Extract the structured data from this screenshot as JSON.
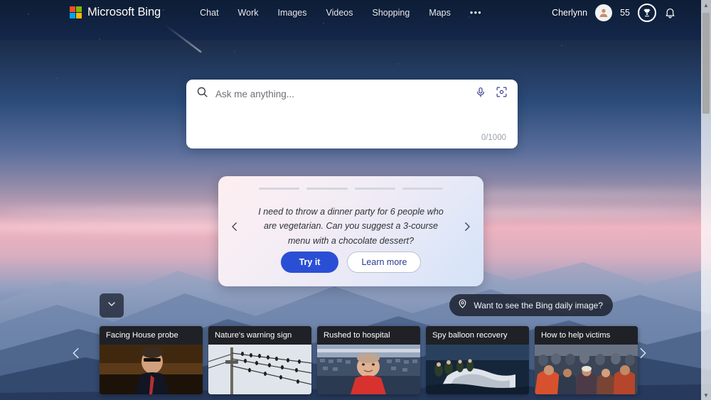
{
  "header": {
    "brand": "Microsoft Bing",
    "logo_icon": "microsoft-squares-logo",
    "logo_colors": [
      "#f25022",
      "#7fba00",
      "#00a4ef",
      "#ffb900"
    ],
    "nav": [
      {
        "label": "Chat",
        "name": "nav-chat"
      },
      {
        "label": "Work",
        "name": "nav-work"
      },
      {
        "label": "Images",
        "name": "nav-images"
      },
      {
        "label": "Videos",
        "name": "nav-videos"
      },
      {
        "label": "Shopping",
        "name": "nav-shopping"
      },
      {
        "label": "Maps",
        "name": "nav-maps"
      }
    ],
    "more_label": "•••",
    "username": "Cherlynn",
    "avatar_icon": "user-avatar-icon",
    "points": "55",
    "rewards_icon": "trophy-icon",
    "notifications_icon": "bell-icon",
    "menu_icon": "hamburger-menu-icon"
  },
  "search": {
    "placeholder": "Ask me anything...",
    "value": "",
    "search_icon": "search-icon",
    "mic_icon": "microphone-icon",
    "visual_icon": "visual-search-camera-icon",
    "counter": "0/1000"
  },
  "suggestion": {
    "prompt": "I need to throw a dinner party for 6 people who are vegetarian. Can you suggest a 3-course menu with a chocolate dessert?",
    "try_label": "Try it",
    "learn_label": "Learn more",
    "prev_icon": "chevron-left-icon",
    "next_icon": "chevron-right-icon",
    "progress": [
      75,
      0,
      0,
      0
    ],
    "active_color": "#2b3a8f"
  },
  "daily_image": {
    "label": "Want to see the Bing daily image?",
    "icon": "location-pin-icon"
  },
  "expand": {
    "icon": "chevron-down-icon"
  },
  "news": {
    "prev_icon": "chevron-left-icon",
    "next_icon": "chevron-right-icon",
    "cards": [
      {
        "headline": "Facing House probe",
        "thumb": "politician-at-hearing"
      },
      {
        "headline": "Nature's warning sign",
        "thumb": "birds-on-power-lines"
      },
      {
        "headline": "Rushed to hospital",
        "thumb": "man-in-red-shirt-stadium"
      },
      {
        "headline": "Spy balloon recovery",
        "thumb": "navy-crew-recovering-debris"
      },
      {
        "headline": "How to help victims",
        "thumb": "crowd-of-people-aid"
      }
    ]
  },
  "scrollbar": {
    "up_icon": "scroll-up-arrow",
    "down_icon": "scroll-down-arrow"
  }
}
